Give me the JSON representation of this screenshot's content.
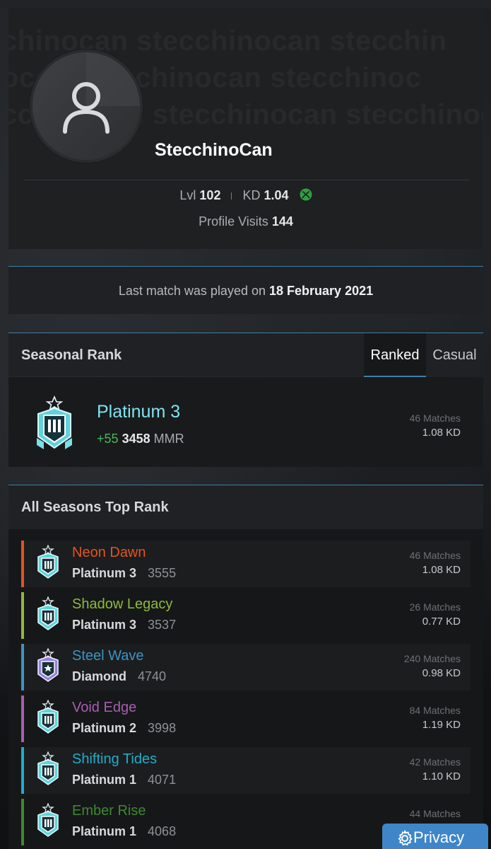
{
  "profile": {
    "watermark_lines": [
      "chinocan stecchinocan stecchin",
      "ocan stecchinocan stecchinoc",
      "cchinocan stecchinocan stecchinocan"
    ],
    "username": "StecchinoCan",
    "level_label": "Lvl",
    "level": "102",
    "kd_label": "KD",
    "kd": "1.04",
    "platform_icon": "xbox-icon",
    "visits_label": "Profile Visits",
    "visits": "144"
  },
  "last_match": {
    "prefix": "Last match was played on",
    "date": "18 February 2021"
  },
  "seasonal": {
    "title": "Seasonal Rank",
    "tabs": [
      {
        "label": "Ranked",
        "active": true
      },
      {
        "label": "Casual",
        "active": false
      }
    ],
    "rank": "Platinum 3",
    "gain": "+55",
    "mmr": "3458",
    "mmr_label": "MMR",
    "matches": "46 Matches",
    "kd": "1.08 KD"
  },
  "all_seasons": {
    "title": "All Seasons Top Rank",
    "rows": [
      {
        "season": "Neon Dawn",
        "color": "#e2541f",
        "rank": "Platinum 3",
        "mmr": "3555",
        "matches": "46 Matches",
        "kd": "1.08 KD",
        "icon": "platinum"
      },
      {
        "season": "Shadow Legacy",
        "color": "#8dbb3b",
        "rank": "Platinum 3",
        "mmr": "3537",
        "matches": "26 Matches",
        "kd": "0.77 KD",
        "icon": "platinum"
      },
      {
        "season": "Steel Wave",
        "color": "#3b95c4",
        "rank": "Diamond",
        "mmr": "4740",
        "matches": "240 Matches",
        "kd": "0.98 KD",
        "icon": "diamond"
      },
      {
        "season": "Void Edge",
        "color": "#a65fb0",
        "rank": "Platinum 2",
        "mmr": "3998",
        "matches": "84 Matches",
        "kd": "1.19 KD",
        "icon": "platinum"
      },
      {
        "season": "Shifting Tides",
        "color": "#1eaecb",
        "rank": "Platinum 1",
        "mmr": "4071",
        "matches": "42 Matches",
        "kd": "1.10 KD",
        "icon": "platinum"
      },
      {
        "season": "Ember Rise",
        "color": "#3d8a2e",
        "rank": "Platinum 1",
        "mmr": "4068",
        "matches": "44 Matches",
        "kd": "",
        "icon": "platinum"
      }
    ]
  },
  "privacy": {
    "label": "Privacy",
    "icon": "gear-icon"
  }
}
